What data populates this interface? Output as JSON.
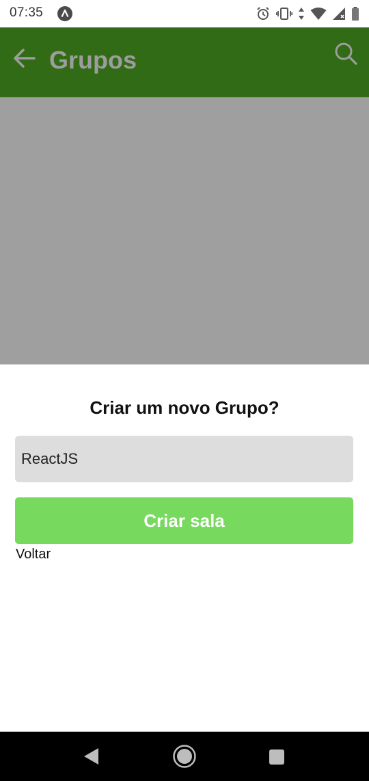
{
  "status_bar": {
    "time": "07:35",
    "icons": [
      "app-notification-icon",
      "alarm-icon",
      "vibrate-icon",
      "data-arrows-icon",
      "wifi-icon",
      "cell-signal-icon",
      "battery-icon"
    ]
  },
  "app_bar": {
    "title": "Grupos",
    "back_icon": "arrow-left-icon",
    "search_icon": "search-icon",
    "background_color": "#316b15",
    "title_color": "#9d9d9d"
  },
  "dialog": {
    "title": "Criar um novo Grupo?",
    "group_name_value": "ReactJS",
    "create_button_label": "Criar sala",
    "back_link_label": "Voltar",
    "button_color": "#77d95e",
    "overlay_color": "#9f9f9f"
  },
  "nav_bar": {
    "icons": [
      "nav-back-icon",
      "nav-home-icon",
      "nav-recents-icon"
    ]
  }
}
